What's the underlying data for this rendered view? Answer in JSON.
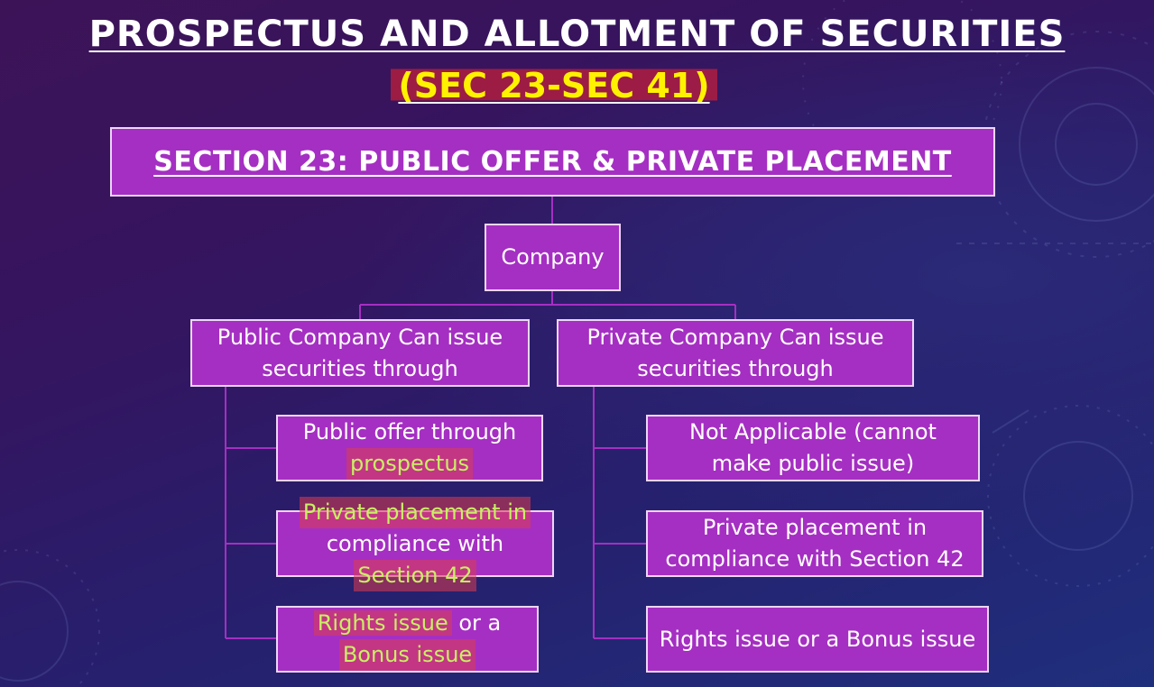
{
  "title": "PROSPECTUS AND ALLOTMENT OF SECURITIES",
  "subtitle": "(SEC 23-SEC 41)",
  "section_heading": "SECTION 23: PUBLIC OFFER & PRIVATE PLACEMENT",
  "root": "Company",
  "public": {
    "heading_line1": "Public Company Can issue",
    "heading_line2": "securities through",
    "item1_line1": "Public offer through",
    "item1_line2": "prospectus",
    "item2_line1": "Private placement in",
    "item2_line2": "compliance with",
    "item2_line3": "Section 42",
    "item3_part1": "Rights issue",
    "item3_part2": " or a",
    "item3_line2": "Bonus issue"
  },
  "private": {
    "heading_line1": "Private Company Can issue",
    "heading_line2": "securities through",
    "item1_line1": "Not Applicable (cannot",
    "item1_line2": "make public issue)",
    "item2_line1": "Private placement in",
    "item2_line2": "compliance with Section 42",
    "item3_line1": "Rights issue or a Bonus issue"
  },
  "colors": {
    "box_fill": "#a52fc2",
    "box_border": "#ecd6f5",
    "highlight_text": "#c8f064",
    "subtitle_text": "#fff200"
  }
}
